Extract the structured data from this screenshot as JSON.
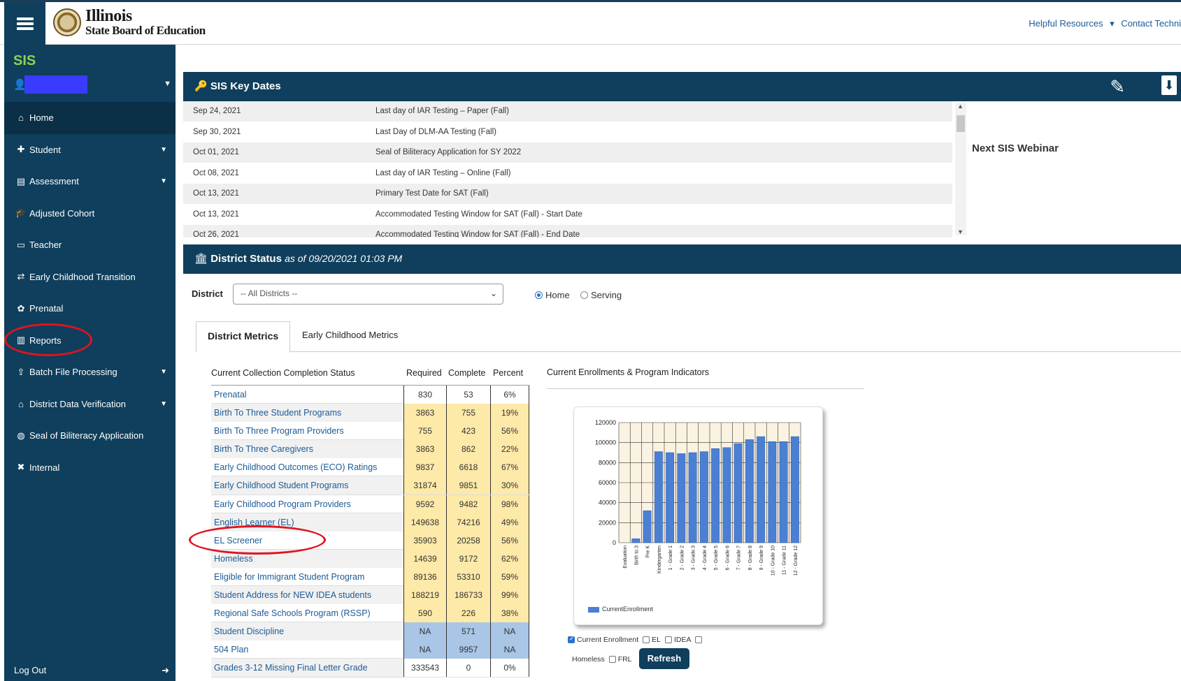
{
  "header": {
    "logo_title": "Illinois",
    "logo_subtitle": "State Board of Education",
    "links": [
      "Helpful Resources",
      "Contact Techni"
    ]
  },
  "sidebar": {
    "app_label": "SIS",
    "items": [
      {
        "label": "Home",
        "icon": "home-icon",
        "caret": false
      },
      {
        "label": "Student",
        "icon": "student-icon",
        "caret": true
      },
      {
        "label": "Assessment",
        "icon": "document-icon",
        "caret": true
      },
      {
        "label": "Adjusted Cohort",
        "icon": "graduation-cap-icon",
        "caret": false
      },
      {
        "label": "Teacher",
        "icon": "chalkboard-icon",
        "caret": false
      },
      {
        "label": "Early Childhood Transition",
        "icon": "exchange-icon",
        "caret": false
      },
      {
        "label": "Prenatal",
        "icon": "baby-icon",
        "caret": false
      },
      {
        "label": "Reports",
        "icon": "chart-icon",
        "caret": false
      },
      {
        "label": "Batch File Processing",
        "icon": "upload-icon",
        "caret": true
      },
      {
        "label": "District Data Verification",
        "icon": "building-icon",
        "caret": true
      },
      {
        "label": "Seal of Biliteracy Application",
        "icon": "globe-icon",
        "caret": false
      },
      {
        "label": "Internal",
        "icon": "tools-icon",
        "caret": false
      }
    ],
    "logout_label": "Log Out"
  },
  "key_dates": {
    "title": "SIS Key Dates",
    "rows": [
      {
        "date": "Sep 24, 2021",
        "event": "Last day of IAR Testing – Paper (Fall)"
      },
      {
        "date": "Sep 30, 2021",
        "event": "Last Day of DLM-AA Testing (Fall)"
      },
      {
        "date": "Oct 01, 2021",
        "event": "Seal of Biliteracy Application for SY 2022"
      },
      {
        "date": "Oct 08, 2021",
        "event": "Last day of IAR Testing – Online (Fall)"
      },
      {
        "date": "Oct 13, 2021",
        "event": "Primary Test Date for SAT (Fall)"
      },
      {
        "date": "Oct 13, 2021",
        "event": "Accommodated Testing Window for SAT (Fall) - Start Date"
      },
      {
        "date": "Oct 26, 2021",
        "event": "Accommodated Testing Window for SAT (Fall) - End Date"
      }
    ],
    "side_title": "Next SIS Webinar"
  },
  "district_status": {
    "title": "District Status",
    "as_of": "as of 09/20/2021 01:03 PM",
    "district_label": "District",
    "district_value": "-- All Districts --",
    "radio_home": "Home",
    "radio_serving": "Serving",
    "tabs": [
      "District Metrics",
      "Early Childhood Metrics"
    ]
  },
  "metrics": {
    "headers": {
      "name": "Current Collection Completion Status",
      "required": "Required",
      "complete": "Complete",
      "percent": "Percent"
    },
    "rows": [
      {
        "name": "Prenatal",
        "required": "830",
        "complete": "53",
        "percent": "6%",
        "color": "w"
      },
      {
        "name": "Birth To Three Student Programs",
        "required": "3863",
        "complete": "755",
        "percent": "19%",
        "color": "y"
      },
      {
        "name": "Birth To Three Program Providers",
        "required": "755",
        "complete": "423",
        "percent": "56%",
        "color": "y"
      },
      {
        "name": "Birth To Three Caregivers",
        "required": "3863",
        "complete": "862",
        "percent": "22%",
        "color": "y"
      },
      {
        "name": "Early Childhood Outcomes (ECO) Ratings",
        "required": "9837",
        "complete": "6618",
        "percent": "67%",
        "color": "y"
      },
      {
        "name": "Early Childhood Student Programs",
        "required": "31874",
        "complete": "9851",
        "percent": "30%",
        "color": "y"
      },
      {
        "name": "Early Childhood Program Providers",
        "required": "9592",
        "complete": "9482",
        "percent": "98%",
        "color": "y"
      },
      {
        "name": "English Learner (EL)",
        "required": "149638",
        "complete": "74216",
        "percent": "49%",
        "color": "y"
      },
      {
        "name": "EL Screener",
        "required": "35903",
        "complete": "20258",
        "percent": "56%",
        "color": "y"
      },
      {
        "name": "Homeless",
        "required": "14639",
        "complete": "9172",
        "percent": "62%",
        "color": "y"
      },
      {
        "name": "Eligible for Immigrant Student Program",
        "required": "89136",
        "complete": "53310",
        "percent": "59%",
        "color": "y"
      },
      {
        "name": "Student Address for NEW IDEA students",
        "required": "188219",
        "complete": "186733",
        "percent": "99%",
        "color": "y"
      },
      {
        "name": "Regional Safe Schools Program (RSSP)",
        "required": "590",
        "complete": "226",
        "percent": "38%",
        "color": "y"
      },
      {
        "name": "Student Discipline",
        "required": "NA",
        "complete": "571",
        "percent": "NA",
        "color": "b"
      },
      {
        "name": "504 Plan",
        "required": "NA",
        "complete": "9957",
        "percent": "NA",
        "color": "b"
      },
      {
        "name": "Grades 3-12 Missing Final Letter Grade",
        "required": "333543",
        "complete": "0",
        "percent": "0%",
        "color": "w"
      }
    ]
  },
  "chart_panel": {
    "title": "Current Enrollments & Program Indicators",
    "checkboxes": [
      {
        "label": "Current Enrollment",
        "checked": true
      },
      {
        "label": "EL",
        "checked": false
      },
      {
        "label": "IDEA",
        "checked": false
      },
      {
        "label": "",
        "checked": false
      },
      {
        "label": "Homeless",
        "checked": false
      },
      {
        "label": "FRL",
        "checked": false
      }
    ],
    "refresh_label": "Refresh"
  },
  "chart_data": {
    "type": "bar",
    "categories": [
      "Evaluation",
      "Birth to 3",
      "Pre K",
      "Kindergarten",
      "1 - Grade 1",
      "2 - Grade 2",
      "3 - Grade 3",
      "4 - Grade 4",
      "5 - Grade 5",
      "6 - Grade 6",
      "7 - Grade 7",
      "8 - Grade 8",
      "9 - Grade 9",
      "10 - Grade 10",
      "11 - Grade 11",
      "12 - Grade 12"
    ],
    "series": [
      {
        "name": "CurrentEnrollment",
        "values": [
          0,
          4000,
          32000,
          91000,
          90000,
          89000,
          90000,
          91000,
          94000,
          95000,
          99000,
          103000,
          106000,
          101000,
          101000,
          106000
        ],
        "color": "#4a7fd4"
      }
    ],
    "ylim": [
      0,
      120000
    ],
    "yticks": [
      "0",
      "20000",
      "40000",
      "60000",
      "80000",
      "100000",
      "120000"
    ],
    "grid": true,
    "legend": "bottom-left"
  }
}
